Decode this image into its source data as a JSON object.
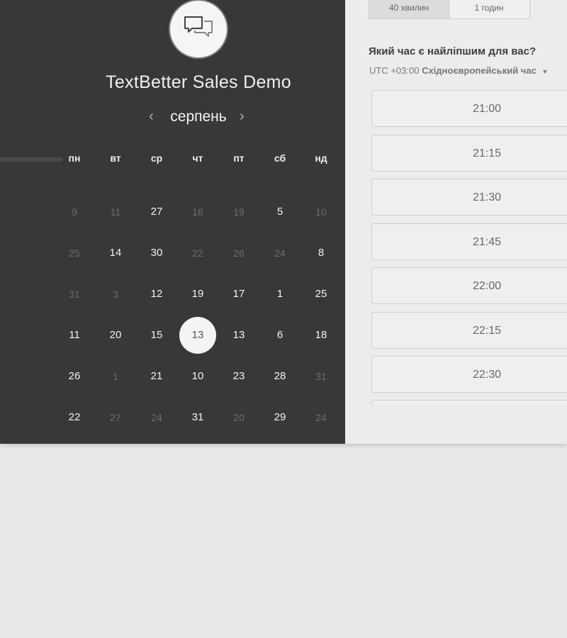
{
  "event": {
    "title": "TextBetter Sales Demo",
    "logo_icon": "chat-bubbles-icon"
  },
  "calendar": {
    "month": "серпень",
    "prev_icon": "‹",
    "next_icon": "›",
    "weekdays": [
      "пн",
      "вт",
      "ср",
      "чт",
      "пт",
      "сб",
      "нд"
    ],
    "weeks": [
      [
        {
          "d": "9",
          "dim": true
        },
        {
          "d": "11",
          "dim": true
        },
        {
          "d": "27",
          "dim": false
        },
        {
          "d": "18",
          "dim": true
        },
        {
          "d": "19",
          "dim": true
        },
        {
          "d": "5",
          "dim": false
        },
        {
          "d": "10",
          "dim": true
        }
      ],
      [
        {
          "d": "25",
          "dim": true
        },
        {
          "d": "14",
          "dim": false
        },
        {
          "d": "30",
          "dim": false
        },
        {
          "d": "22",
          "dim": true
        },
        {
          "d": "26",
          "dim": true
        },
        {
          "d": "24",
          "dim": true
        },
        {
          "d": "8",
          "dim": false
        }
      ],
      [
        {
          "d": "31",
          "dim": true
        },
        {
          "d": "3",
          "dim": true
        },
        {
          "d": "12",
          "dim": false
        },
        {
          "d": "19",
          "dim": false
        },
        {
          "d": "17",
          "dim": false
        },
        {
          "d": "1",
          "dim": false
        },
        {
          "d": "25",
          "dim": false
        }
      ],
      [
        {
          "d": "11",
          "dim": false
        },
        {
          "d": "20",
          "dim": false
        },
        {
          "d": "15",
          "dim": false
        },
        {
          "d": "13",
          "dim": false,
          "selected": true
        },
        {
          "d": "13",
          "dim": false
        },
        {
          "d": "6",
          "dim": false
        },
        {
          "d": "18",
          "dim": false
        }
      ],
      [
        {
          "d": "26",
          "dim": false
        },
        {
          "d": "1",
          "dim": true
        },
        {
          "d": "21",
          "dim": false
        },
        {
          "d": "10",
          "dim": false
        },
        {
          "d": "23",
          "dim": false
        },
        {
          "d": "28",
          "dim": false
        },
        {
          "d": "31",
          "dim": true
        }
      ],
      [
        {
          "d": "22",
          "dim": false
        },
        {
          "d": "27",
          "dim": true
        },
        {
          "d": "24",
          "dim": true
        },
        {
          "d": "31",
          "dim": false
        },
        {
          "d": "20",
          "dim": true
        },
        {
          "d": "29",
          "dim": false
        },
        {
          "d": "24",
          "dim": true
        }
      ]
    ]
  },
  "duration": {
    "options": [
      "40 хвилин",
      "1 годин"
    ],
    "active_index": 0
  },
  "schedule": {
    "question": "Який час є найліпшим для вас?",
    "timezone_prefix": "UTC +03:00",
    "timezone_name": "Східноєвропейський час",
    "slots": [
      "21:00",
      "21:15",
      "21:30",
      "21:45",
      "22:00",
      "22:15",
      "22:30"
    ]
  }
}
